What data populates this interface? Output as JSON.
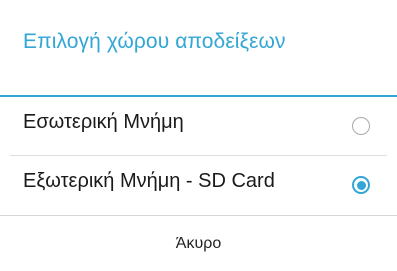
{
  "dialog": {
    "title": "Επιλογή χώρου αποδείξεων",
    "options": [
      {
        "label": "Εσωτερική Μνήμη",
        "selected": false
      },
      {
        "label": "Εξωτερική Μνήμη - SD Card",
        "selected": true
      }
    ],
    "cancel_label": "Άκυρο",
    "accent_color": "#33a6d6"
  }
}
